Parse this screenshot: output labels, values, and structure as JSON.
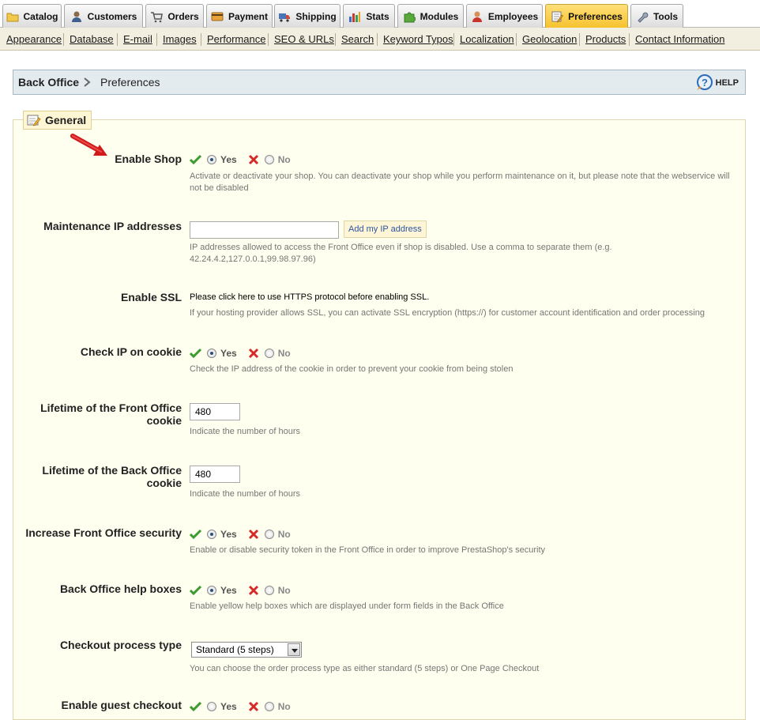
{
  "tabs": [
    {
      "label": "Catalog",
      "icon": "folder-icon"
    },
    {
      "label": "Customers",
      "icon": "user-icon"
    },
    {
      "label": "Orders",
      "icon": "cart-icon"
    },
    {
      "label": "Payment",
      "icon": "credit-card-icon"
    },
    {
      "label": "Shipping",
      "icon": "truck-icon"
    },
    {
      "label": "Stats",
      "icon": "bar-chart-icon"
    },
    {
      "label": "Modules",
      "icon": "puzzle-icon"
    },
    {
      "label": "Employees",
      "icon": "employee-icon"
    },
    {
      "label": "Preferences",
      "icon": "preferences-icon",
      "active": true
    },
    {
      "label": "Tools",
      "icon": "wrench-icon"
    }
  ],
  "submenu": [
    "Appearance",
    "Database",
    "E-mail",
    "Images",
    "Performance",
    "SEO & URLs",
    "Search",
    "Keyword Typos",
    "Localization",
    "Geolocation",
    "Products",
    "Contact Information"
  ],
  "breadcrumb": {
    "root": "Back Office",
    "current": "Preferences",
    "help": "HELP"
  },
  "section": {
    "legend": "General"
  },
  "radio_labels": {
    "yes": "Yes",
    "no": "No"
  },
  "fields": {
    "enable_shop": {
      "label": "Enable Shop",
      "value": "yes",
      "hint": "Activate or deactivate your shop. You can deactivate your shop while you perform maintenance on it, but please note that the webservice will not be disabled"
    },
    "maintenance_ip": {
      "label": "Maintenance IP addresses",
      "value": "",
      "button": "Add my IP address",
      "hint": "IP addresses allowed to access the Front Office even if shop is disabled. Use a comma to separate them (e.g. 42.24.4.2,127.0.0.1,99.98.97.96)"
    },
    "enable_ssl": {
      "label": "Enable SSL",
      "text": "Please click here to use HTTPS protocol before enabling SSL.",
      "hint": "If your hosting provider allows SSL, you can activate SSL encryption (https://) for customer account identification and order processing"
    },
    "check_ip_cookie": {
      "label": "Check IP on cookie",
      "value": "yes",
      "hint": "Check the IP address of the cookie in order to prevent your cookie from being stolen"
    },
    "front_cookie": {
      "label": "Lifetime of the Front Office cookie",
      "value": "480",
      "hint": "Indicate the number of hours"
    },
    "back_cookie": {
      "label": "Lifetime of the Back Office cookie",
      "value": "480",
      "hint": "Indicate the number of hours"
    },
    "front_security": {
      "label": "Increase Front Office security",
      "value": "yes",
      "hint": "Enable or disable security token in the Front Office in order to improve PrestaShop's security"
    },
    "help_boxes": {
      "label": "Back Office help boxes",
      "value": "yes",
      "hint": "Enable yellow help boxes which are displayed under form fields in the Back Office"
    },
    "checkout_type": {
      "label": "Checkout process type",
      "value": "Standard (5 steps)",
      "hint": "You can choose the order process type as either standard (5 steps) or One Page Checkout"
    },
    "guest_checkout": {
      "label": "Enable guest checkout"
    }
  },
  "colors": {
    "active_tab": "#f6c02b",
    "panel_bg": "#fffff0",
    "link": "#2b55a0",
    "check": "#3c9a2e",
    "cross": "#d62a2a"
  }
}
